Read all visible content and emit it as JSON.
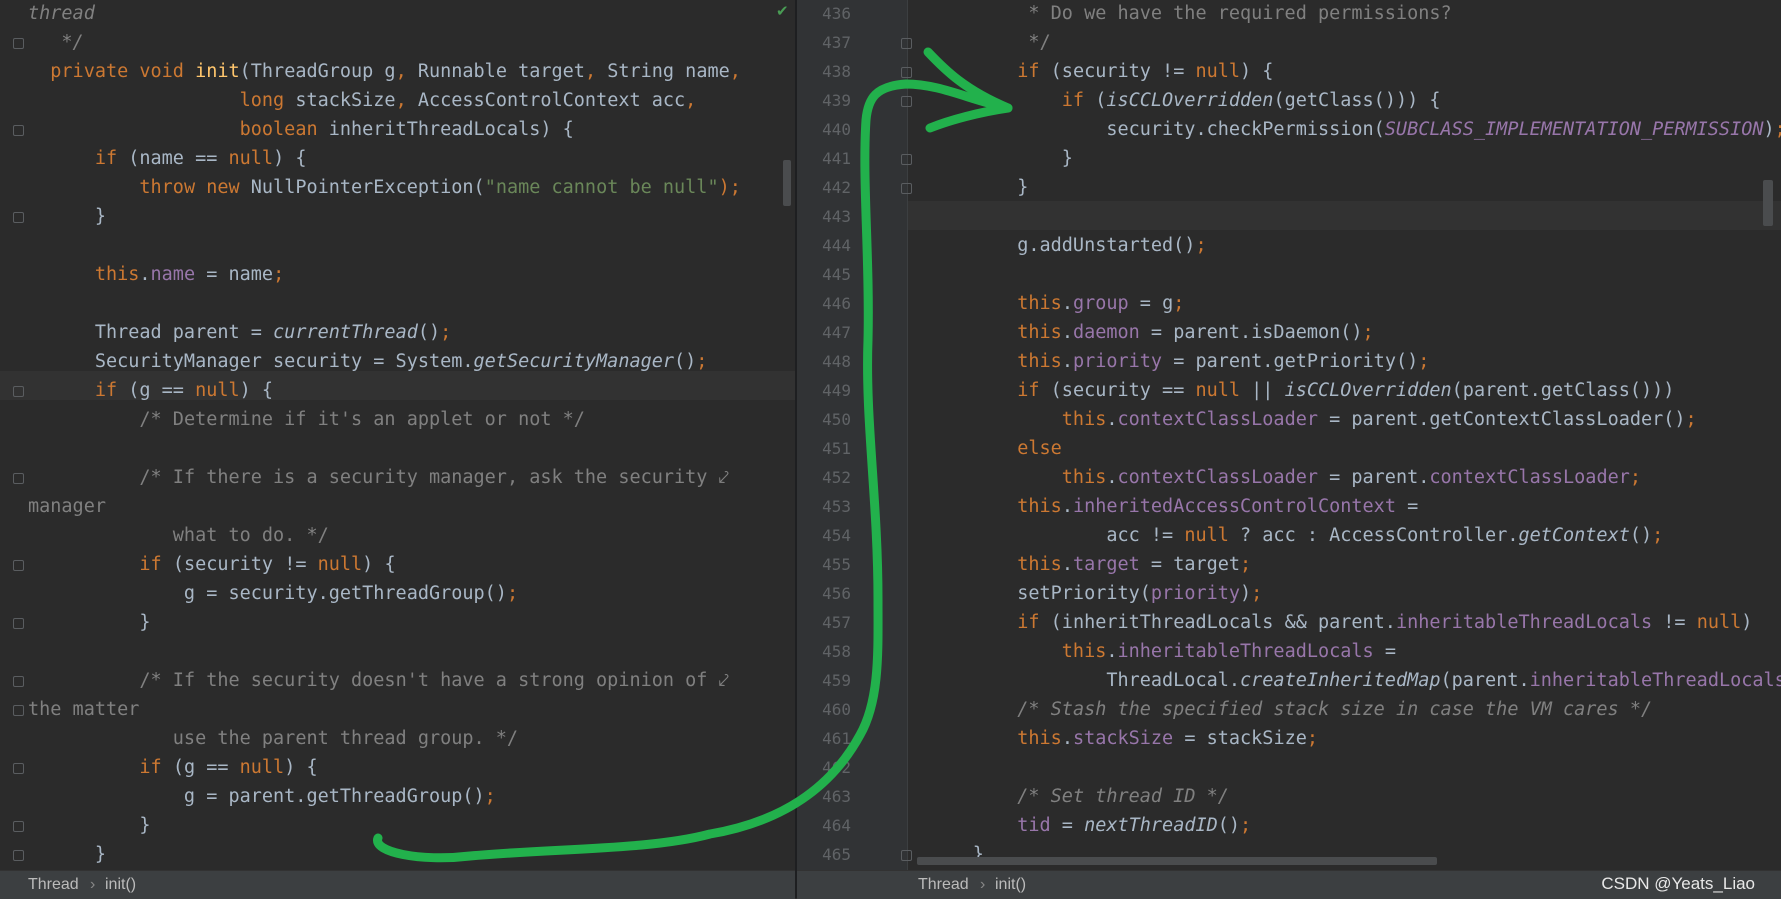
{
  "left_editor": {
    "lines": [
      {
        "x": 28,
        "segs": [
          {
            "t": "thread",
            "c": "cm ital"
          }
        ]
      },
      {
        "x": 28,
        "segs": [
          {
            "t": "   */",
            "c": "cm ital"
          }
        ]
      },
      {
        "x": 28,
        "segs": [
          {
            "t": "  private void ",
            "c": "kw"
          },
          {
            "t": "init",
            "c": "fn"
          },
          {
            "t": "(ThreadGroup g",
            "c": ""
          },
          {
            "t": ", ",
            "c": "kw"
          },
          {
            "t": "Runnable target",
            "c": ""
          },
          {
            "t": ", ",
            "c": "kw"
          },
          {
            "t": "String name",
            "c": ""
          },
          {
            "t": ",",
            "c": "kw"
          }
        ]
      },
      {
        "x": 28,
        "segs": [
          {
            "t": "                   ",
            "c": ""
          },
          {
            "t": "long ",
            "c": "kw"
          },
          {
            "t": "stackSize",
            "c": ""
          },
          {
            "t": ", ",
            "c": "kw"
          },
          {
            "t": "AccessControlContext acc",
            "c": ""
          },
          {
            "t": ",",
            "c": "kw"
          }
        ]
      },
      {
        "x": 28,
        "segs": [
          {
            "t": "                   ",
            "c": ""
          },
          {
            "t": "boolean ",
            "c": "kw"
          },
          {
            "t": "inheritThreadLocals) {",
            "c": ""
          }
        ]
      },
      {
        "x": 28,
        "segs": [
          {
            "t": "      ",
            "c": ""
          },
          {
            "t": "if ",
            "c": "kw"
          },
          {
            "t": "(name == ",
            "c": ""
          },
          {
            "t": "null",
            "c": "kw"
          },
          {
            "t": ") {",
            "c": ""
          }
        ]
      },
      {
        "x": 28,
        "segs": [
          {
            "t": "          ",
            "c": ""
          },
          {
            "t": "throw new ",
            "c": "kw"
          },
          {
            "t": "NullPointerException(",
            "c": ""
          },
          {
            "t": "\"name cannot be null\"",
            "c": "str"
          },
          {
            "t": ");",
            "c": "kw"
          }
        ]
      },
      {
        "x": 28,
        "segs": [
          {
            "t": "      }",
            "c": ""
          }
        ]
      },
      {
        "x": 28,
        "segs": []
      },
      {
        "x": 28,
        "segs": [
          {
            "t": "      ",
            "c": ""
          },
          {
            "t": "this",
            "c": "kw"
          },
          {
            "t": ".",
            "c": ""
          },
          {
            "t": "name",
            "c": "fld"
          },
          {
            "t": " = name",
            "c": ""
          },
          {
            "t": ";",
            "c": "kw"
          }
        ]
      },
      {
        "x": 28,
        "segs": []
      },
      {
        "x": 28,
        "segs": [
          {
            "t": "      Thread parent = ",
            "c": ""
          },
          {
            "t": "currentThread",
            "c": "ital"
          },
          {
            "t": "()",
            "c": ""
          },
          {
            "t": ";",
            "c": "kw"
          }
        ]
      },
      {
        "x": 28,
        "segs": [
          {
            "t": "      SecurityManager security = System.",
            "c": ""
          },
          {
            "t": "getSecurityManager",
            "c": "ital"
          },
          {
            "t": "()",
            "c": ""
          },
          {
            "t": ";",
            "c": "kw"
          }
        ]
      },
      {
        "x": 28,
        "segs": [
          {
            "t": "      ",
            "c": ""
          },
          {
            "t": "if ",
            "c": "kw"
          },
          {
            "t": "(g == ",
            "c": ""
          },
          {
            "t": "null",
            "c": "kw"
          },
          {
            "t": ") {",
            "c": ""
          }
        ]
      },
      {
        "x": 28,
        "segs": [
          {
            "t": "          ",
            "c": ""
          },
          {
            "t": "/* Determine if it's an applet or not */",
            "c": "cm"
          }
        ]
      },
      {
        "x": 28,
        "segs": []
      },
      {
        "x": 28,
        "segs": [
          {
            "t": "          ",
            "c": ""
          },
          {
            "t": "/* If there is a security manager, ask the security ⤦",
            "c": "cm"
          }
        ]
      },
      {
        "x": 28,
        "segs": [
          {
            "t": "manager",
            "c": "cm"
          }
        ]
      },
      {
        "x": 28,
        "segs": [
          {
            "t": "             ",
            "c": ""
          },
          {
            "t": "what to do. */",
            "c": "cm"
          }
        ]
      },
      {
        "x": 28,
        "segs": [
          {
            "t": "          ",
            "c": ""
          },
          {
            "t": "if ",
            "c": "kw"
          },
          {
            "t": "(security != ",
            "c": ""
          },
          {
            "t": "null",
            "c": "kw"
          },
          {
            "t": ") {",
            "c": ""
          }
        ]
      },
      {
        "x": 28,
        "segs": [
          {
            "t": "              g = security.getThreadGroup()",
            "c": ""
          },
          {
            "t": ";",
            "c": "kw"
          }
        ]
      },
      {
        "x": 28,
        "segs": [
          {
            "t": "          }",
            "c": ""
          }
        ]
      },
      {
        "x": 28,
        "segs": []
      },
      {
        "x": 28,
        "segs": [
          {
            "t": "          ",
            "c": ""
          },
          {
            "t": "/* If the security doesn't have a strong opinion of ⤦",
            "c": "cm"
          }
        ]
      },
      {
        "x": 28,
        "segs": [
          {
            "t": "the matter",
            "c": "cm"
          }
        ]
      },
      {
        "x": 28,
        "segs": [
          {
            "t": "             ",
            "c": ""
          },
          {
            "t": "use the parent thread group. */",
            "c": "cm"
          }
        ]
      },
      {
        "x": 28,
        "segs": [
          {
            "t": "          ",
            "c": ""
          },
          {
            "t": "if ",
            "c": "kw"
          },
          {
            "t": "(g == ",
            "c": ""
          },
          {
            "t": "null",
            "c": "kw"
          },
          {
            "t": ") {",
            "c": ""
          }
        ]
      },
      {
        "x": 28,
        "segs": [
          {
            "t": "              g = parent.getThreadGroup()",
            "c": ""
          },
          {
            "t": ";",
            "c": "kw"
          }
        ]
      },
      {
        "x": 28,
        "segs": [
          {
            "t": "          }",
            "c": ""
          }
        ]
      },
      {
        "x": 28,
        "segs": [
          {
            "t": "      }",
            "c": ""
          }
        ]
      }
    ]
  },
  "right_editor": {
    "line_numbers": [
      "436",
      "437",
      "438",
      "439",
      "440",
      "441",
      "442",
      "443",
      "444",
      "445",
      "446",
      "447",
      "448",
      "449",
      "450",
      "451",
      "452",
      "453",
      "454",
      "455",
      "456",
      "457",
      "458",
      "459",
      "460",
      "461",
      "462",
      "463",
      "464",
      "465"
    ],
    "lines": [
      {
        "segs": [
          {
            "t": "          * Do we have the required permissions?",
            "c": "cm"
          }
        ]
      },
      {
        "segs": [
          {
            "t": "          */",
            "c": "cm"
          }
        ]
      },
      {
        "segs": [
          {
            "t": "         ",
            "c": ""
          },
          {
            "t": "if ",
            "c": "kw"
          },
          {
            "t": "(security != ",
            "c": ""
          },
          {
            "t": "null",
            "c": "kw"
          },
          {
            "t": ") {",
            "c": ""
          }
        ]
      },
      {
        "segs": [
          {
            "t": "             ",
            "c": ""
          },
          {
            "t": "if ",
            "c": "kw"
          },
          {
            "t": "(",
            "c": ""
          },
          {
            "t": "isCCLOverridden",
            "c": "ital"
          },
          {
            "t": "(getClass())) {",
            "c": ""
          }
        ]
      },
      {
        "segs": [
          {
            "t": "                 security.checkPermission(",
            "c": ""
          },
          {
            "t": "SUBCLASS_IMPLEMENTATION_PERMISSION",
            "c": "cst"
          },
          {
            "t": ")",
            "c": ""
          },
          {
            "t": ";",
            "c": "kw"
          }
        ]
      },
      {
        "segs": [
          {
            "t": "             }",
            "c": ""
          }
        ]
      },
      {
        "segs": [
          {
            "t": "         }",
            "c": ""
          }
        ]
      },
      {
        "segs": []
      },
      {
        "segs": [
          {
            "t": "         g.addUnstarted()",
            "c": ""
          },
          {
            "t": ";",
            "c": "kw"
          }
        ]
      },
      {
        "segs": []
      },
      {
        "segs": [
          {
            "t": "         ",
            "c": ""
          },
          {
            "t": "this",
            "c": "kw"
          },
          {
            "t": ".",
            "c": ""
          },
          {
            "t": "group",
            "c": "fld"
          },
          {
            "t": " = g",
            "c": ""
          },
          {
            "t": ";",
            "c": "kw"
          }
        ]
      },
      {
        "segs": [
          {
            "t": "         ",
            "c": ""
          },
          {
            "t": "this",
            "c": "kw"
          },
          {
            "t": ".",
            "c": ""
          },
          {
            "t": "daemon",
            "c": "fld"
          },
          {
            "t": " = parent.isDaemon()",
            "c": ""
          },
          {
            "t": ";",
            "c": "kw"
          }
        ]
      },
      {
        "segs": [
          {
            "t": "         ",
            "c": ""
          },
          {
            "t": "this",
            "c": "kw"
          },
          {
            "t": ".",
            "c": ""
          },
          {
            "t": "priority",
            "c": "fld"
          },
          {
            "t": " = parent.getPriority()",
            "c": ""
          },
          {
            "t": ";",
            "c": "kw"
          }
        ]
      },
      {
        "segs": [
          {
            "t": "         ",
            "c": ""
          },
          {
            "t": "if ",
            "c": "kw"
          },
          {
            "t": "(security == ",
            "c": ""
          },
          {
            "t": "null ",
            "c": "kw"
          },
          {
            "t": "|| ",
            "c": ""
          },
          {
            "t": "isCCLOverridden",
            "c": "ital"
          },
          {
            "t": "(parent.getClass()))",
            "c": ""
          }
        ]
      },
      {
        "segs": [
          {
            "t": "             ",
            "c": ""
          },
          {
            "t": "this",
            "c": "kw"
          },
          {
            "t": ".",
            "c": ""
          },
          {
            "t": "contextClassLoader",
            "c": "fld"
          },
          {
            "t": " = parent.getContextClassLoader()",
            "c": ""
          },
          {
            "t": ";",
            "c": "kw"
          }
        ]
      },
      {
        "segs": [
          {
            "t": "         ",
            "c": ""
          },
          {
            "t": "else",
            "c": "kw"
          }
        ]
      },
      {
        "segs": [
          {
            "t": "             ",
            "c": ""
          },
          {
            "t": "this",
            "c": "kw"
          },
          {
            "t": ".",
            "c": ""
          },
          {
            "t": "contextClassLoader",
            "c": "fld"
          },
          {
            "t": " = parent.",
            "c": ""
          },
          {
            "t": "contextClassLoader",
            "c": "fld"
          },
          {
            "t": ";",
            "c": "kw"
          }
        ]
      },
      {
        "segs": [
          {
            "t": "         ",
            "c": ""
          },
          {
            "t": "this",
            "c": "kw"
          },
          {
            "t": ".",
            "c": ""
          },
          {
            "t": "inheritedAccessControlContext",
            "c": "fld"
          },
          {
            "t": " =",
            "c": ""
          }
        ]
      },
      {
        "segs": [
          {
            "t": "                 acc != ",
            "c": ""
          },
          {
            "t": "null ",
            "c": "kw"
          },
          {
            "t": "? acc : AccessController.",
            "c": ""
          },
          {
            "t": "getContext",
            "c": "ital"
          },
          {
            "t": "()",
            "c": ""
          },
          {
            "t": ";",
            "c": "kw"
          }
        ]
      },
      {
        "segs": [
          {
            "t": "         ",
            "c": ""
          },
          {
            "t": "this",
            "c": "kw"
          },
          {
            "t": ".",
            "c": ""
          },
          {
            "t": "target",
            "c": "fld"
          },
          {
            "t": " = target",
            "c": ""
          },
          {
            "t": ";",
            "c": "kw"
          }
        ]
      },
      {
        "segs": [
          {
            "t": "         setPriority(",
            "c": ""
          },
          {
            "t": "priority",
            "c": "fld"
          },
          {
            "t": ")",
            "c": ""
          },
          {
            "t": ";",
            "c": "kw"
          }
        ]
      },
      {
        "segs": [
          {
            "t": "         ",
            "c": ""
          },
          {
            "t": "if ",
            "c": "kw"
          },
          {
            "t": "(inheritThreadLocals && parent.",
            "c": ""
          },
          {
            "t": "inheritableThreadLocals",
            "c": "fld"
          },
          {
            "t": " != ",
            "c": ""
          },
          {
            "t": "null",
            "c": "kw"
          },
          {
            "t": ")",
            "c": ""
          }
        ]
      },
      {
        "segs": [
          {
            "t": "             ",
            "c": ""
          },
          {
            "t": "this",
            "c": "kw"
          },
          {
            "t": ".",
            "c": ""
          },
          {
            "t": "inheritableThreadLocals",
            "c": "fld"
          },
          {
            "t": " =",
            "c": ""
          }
        ]
      },
      {
        "segs": [
          {
            "t": "                 ThreadLocal.",
            "c": ""
          },
          {
            "t": "createInheritedMap",
            "c": "ital"
          },
          {
            "t": "(parent.",
            "c": ""
          },
          {
            "t": "inheritableThreadLocals",
            "c": "fld"
          },
          {
            "t": ")",
            "c": ""
          }
        ]
      },
      {
        "segs": [
          {
            "t": "         ",
            "c": ""
          },
          {
            "t": "/* Stash the specified stack size in case the VM cares */",
            "c": "cm ital"
          }
        ]
      },
      {
        "segs": [
          {
            "t": "         ",
            "c": ""
          },
          {
            "t": "this",
            "c": "kw"
          },
          {
            "t": ".",
            "c": ""
          },
          {
            "t": "stackSize",
            "c": "fld"
          },
          {
            "t": " = stackSize",
            "c": ""
          },
          {
            "t": ";",
            "c": "kw"
          }
        ]
      },
      {
        "segs": []
      },
      {
        "segs": [
          {
            "t": "         ",
            "c": ""
          },
          {
            "t": "/* Set thread ID */",
            "c": "cm ital"
          }
        ]
      },
      {
        "segs": [
          {
            "t": "         ",
            "c": ""
          },
          {
            "t": "tid",
            "c": "fld"
          },
          {
            "t": " = ",
            "c": ""
          },
          {
            "t": "nextThreadID",
            "c": "ital"
          },
          {
            "t": "()",
            "c": ""
          },
          {
            "t": ";",
            "c": "kw"
          }
        ]
      },
      {
        "segs": [
          {
            "t": "     }",
            "c": ""
          }
        ]
      }
    ]
  },
  "left_breadcrumb": {
    "class": "Thread",
    "sep": "›",
    "method": "init()"
  },
  "right_breadcrumb": {
    "class": "Thread",
    "sep": "›",
    "method": "init()"
  },
  "watermark": "CSDN @Yeats_Liao",
  "annotation": {
    "color": "#22b14c",
    "icon": "hand-drawn-arrow"
  },
  "colors": {
    "background": "#2b2b2b",
    "keyword": "#cc7832",
    "string": "#6a8759",
    "comment": "#808080",
    "field": "#9876aa",
    "method": "#ffc66d",
    "text": "#a9b7c6"
  }
}
